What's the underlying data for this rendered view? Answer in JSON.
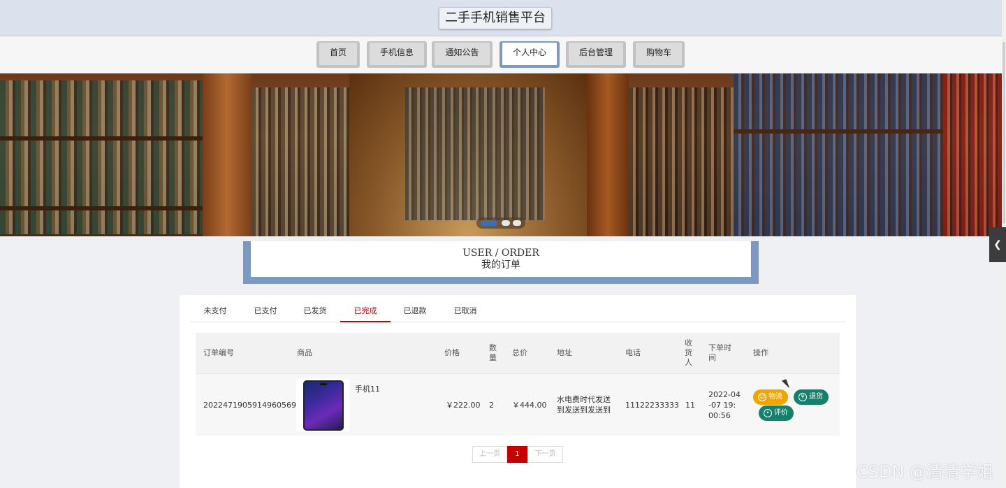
{
  "header": {
    "site_title": "二手手机销售平台"
  },
  "nav": {
    "items": [
      {
        "label": "首页"
      },
      {
        "label": "手机信息"
      },
      {
        "label": "通知公告"
      },
      {
        "label": "个人中心"
      },
      {
        "label": "后台管理"
      },
      {
        "label": "购物车"
      }
    ],
    "active": "个人中心"
  },
  "page_title": {
    "en": "USER / ORDER",
    "cn": "我的订单"
  },
  "tabs": {
    "items": [
      {
        "label": "未支付"
      },
      {
        "label": "已支付"
      },
      {
        "label": "已发货"
      },
      {
        "label": "已完成"
      },
      {
        "label": "已退款"
      },
      {
        "label": "已取消"
      }
    ],
    "active": "已完成"
  },
  "table": {
    "headers": {
      "order_no": "订单编号",
      "goods": "商品",
      "price": "价格",
      "qty": "数量",
      "total": "总价",
      "address": "地址",
      "phone": "电话",
      "receiver": "收货人",
      "order_time": "下单时间",
      "actions": "操作"
    },
    "rows": [
      {
        "order_no": "2022471905914960569",
        "goods_name": "手机11",
        "price": "￥222.00",
        "qty": "2",
        "total": "￥444.00",
        "address": "水电费时代发送到发送到发送到",
        "phone": "11122233333",
        "receiver": "11",
        "order_time": "2022-04-07 19:00:56",
        "actions": {
          "logistics": "物流",
          "refund": "退货",
          "review": "评价"
        }
      }
    ]
  },
  "pagination": {
    "prev": "上一页",
    "current": "1",
    "next": "下一页"
  },
  "side_toggle_icon": "chevron-left-icon",
  "watermark": "CSDN @清清学姐",
  "colors": {
    "accent_blue": "#7d99c2",
    "active_red": "#c40000",
    "btn_orange": "#f0a500",
    "btn_teal": "#15806b"
  }
}
